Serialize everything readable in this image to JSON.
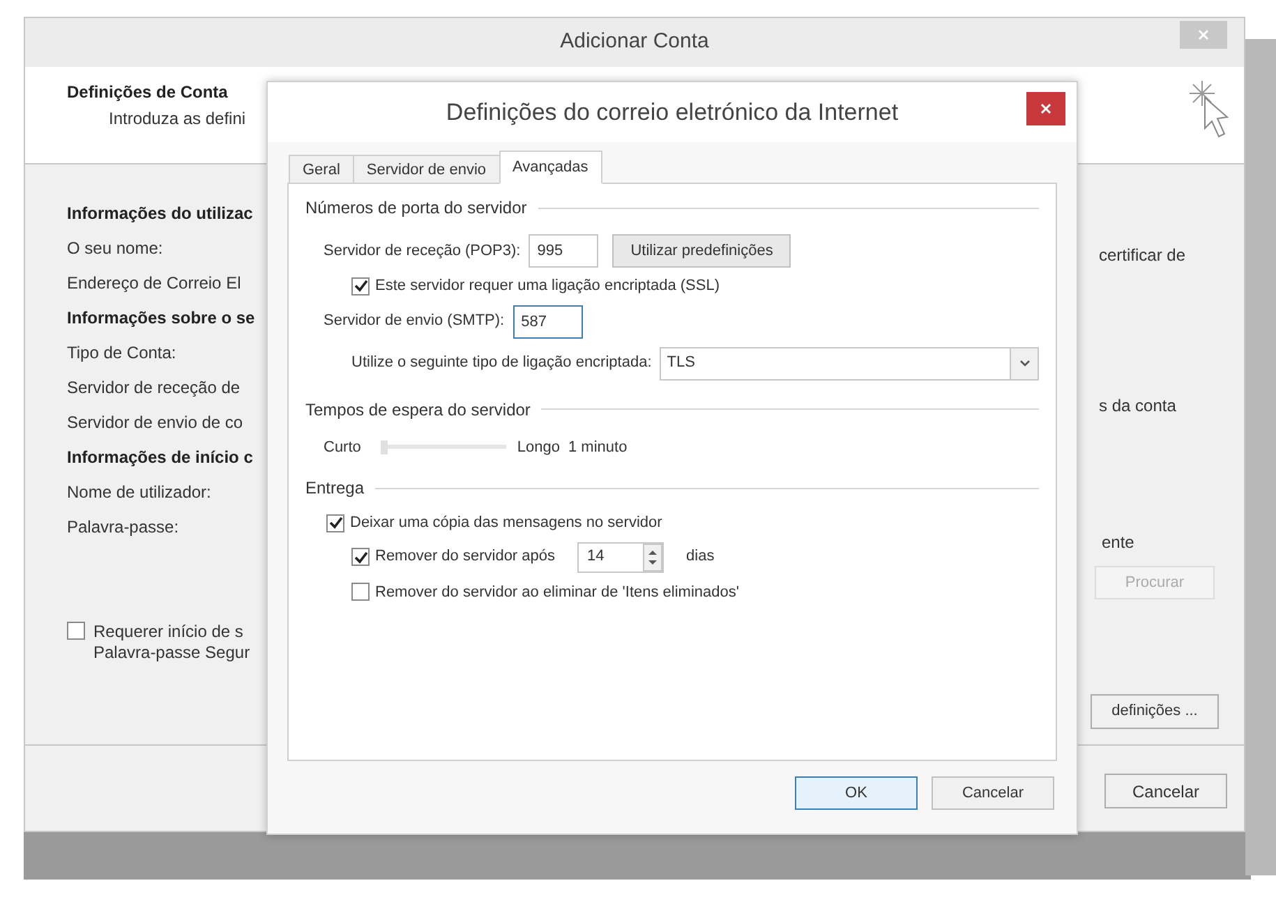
{
  "window": {
    "title": "Adicionar Conta"
  },
  "header": {
    "title": "Definições de Conta",
    "subtitle": "Introduza as defini"
  },
  "left_panel": {
    "rows": [
      {
        "kind": "heading",
        "text": "Informações do utilizac"
      },
      {
        "kind": "label",
        "text": "O seu nome:"
      },
      {
        "kind": "label",
        "text": "Endereço de Correio El"
      },
      {
        "kind": "heading",
        "text": "Informações sobre o se"
      },
      {
        "kind": "label",
        "text": "Tipo de Conta:"
      },
      {
        "kind": "label",
        "text": "Servidor de receção de"
      },
      {
        "kind": "label",
        "text": "Servidor de envio de co"
      },
      {
        "kind": "heading",
        "text": "Informações de início c"
      },
      {
        "kind": "label",
        "text": "Nome de utilizador:"
      },
      {
        "kind": "label",
        "text": "Palavra-passe:"
      }
    ],
    "checkbox": {
      "lines": [
        "Requerer início de s",
        "Palavra-passe Segur"
      ],
      "checked": false
    }
  },
  "right_panel": {
    "texts": [
      "certificar de",
      "s da conta",
      "ente"
    ],
    "browse_button": {
      "label": "Procurar",
      "disabled": true
    },
    "settings_button": {
      "label": "definições ..."
    },
    "cancel_button": {
      "label": "Cancelar"
    }
  },
  "dialog": {
    "title": "Definições do correio eletrónico da Internet",
    "tabs": [
      {
        "label": "Geral",
        "selected": false
      },
      {
        "label": "Servidor de envio",
        "selected": false
      },
      {
        "label": "Avançadas",
        "selected": true
      }
    ],
    "ports": {
      "title": "Números de porta do servidor",
      "incoming": {
        "label": "Servidor de receção (POP3):",
        "value": "995"
      },
      "defaults_button": "Utilizar predefinições",
      "ssl": {
        "label": "Este servidor requer uma ligação encriptada (SSL)",
        "checked": true
      },
      "outgoing": {
        "label": "Servidor de envio (SMTP):",
        "value": "587",
        "focused": true
      },
      "encryption": {
        "label": "Utilize o seguinte tipo de ligação encriptada:",
        "value": "TLS"
      }
    },
    "timeouts": {
      "title": "Tempos de espera do servidor",
      "min_label": "Curto",
      "max_label": "Longo",
      "level": 0,
      "reading": "1 minuto"
    },
    "delivery": {
      "title": "Entrega",
      "leave_copy": {
        "label": "Deixar uma cópia das mensagens no servidor",
        "checked": true
      },
      "remove_after": {
        "label": "Remover do servidor após",
        "checked": true,
        "value": "14",
        "unit": "dias"
      },
      "remove_on_delete": {
        "label": "Remover do servidor ao eliminar de 'Itens eliminados'",
        "checked": false
      }
    },
    "buttons": [
      {
        "label": "OK",
        "default": true
      },
      {
        "label": "Cancelar",
        "default": false
      }
    ]
  }
}
